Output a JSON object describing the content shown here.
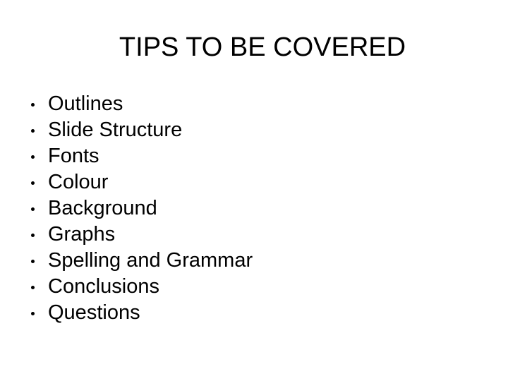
{
  "slide": {
    "title": "TIPS TO BE COVERED",
    "background_color": "#ffffff",
    "text_color": "#000000",
    "bullet_marker_icon": "round-bullet-icon",
    "bullets": [
      {
        "label": "Outlines"
      },
      {
        "label": "Slide Structure"
      },
      {
        "label": "Fonts"
      },
      {
        "label": "Colour"
      },
      {
        "label": "Background"
      },
      {
        "label": "Graphs"
      },
      {
        "label": "Spelling and Grammar"
      },
      {
        "label": "Conclusions"
      },
      {
        "label": "Questions"
      }
    ]
  }
}
